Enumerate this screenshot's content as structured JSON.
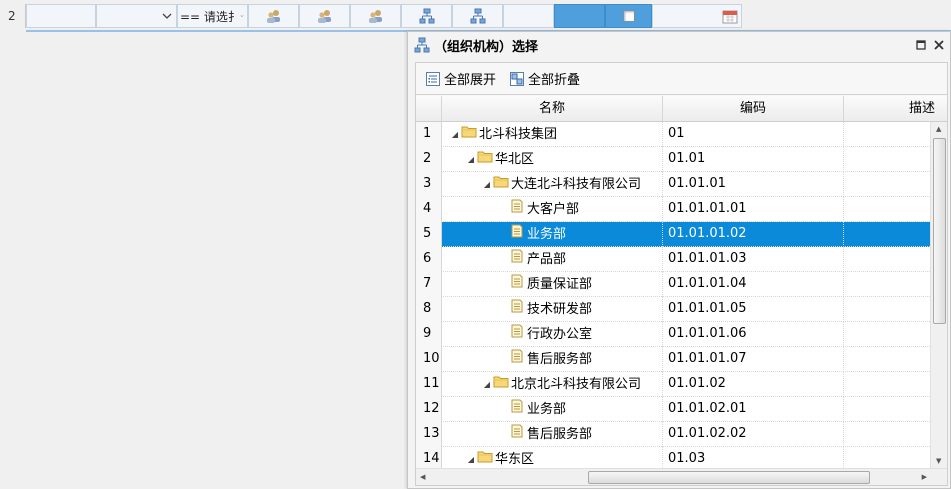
{
  "toprow": {
    "row_number": "2",
    "compare_text": "== 请选扌"
  },
  "dialog": {
    "title": "（组织机构）选择",
    "toolbar": {
      "expand_all": "全部展开",
      "collapse_all": "全部折叠"
    },
    "columns": [
      "名称",
      "编码",
      "描述"
    ],
    "rows": [
      {
        "num": "1",
        "level": 0,
        "type": "folder",
        "name": "北斗科技集团",
        "code": "01"
      },
      {
        "num": "2",
        "level": 1,
        "type": "folder",
        "name": "华北区",
        "code": "01.01"
      },
      {
        "num": "3",
        "level": 2,
        "type": "folder",
        "name": "大连北斗科技有限公司",
        "code": "01.01.01"
      },
      {
        "num": "4",
        "level": 3,
        "type": "leaf",
        "name": "大客户部",
        "code": "01.01.01.01"
      },
      {
        "num": "5",
        "level": 3,
        "type": "leaf",
        "name": "业务部",
        "code": "01.01.01.02"
      },
      {
        "num": "6",
        "level": 3,
        "type": "leaf",
        "name": "产品部",
        "code": "01.01.01.03"
      },
      {
        "num": "7",
        "level": 3,
        "type": "leaf",
        "name": "质量保证部",
        "code": "01.01.01.04"
      },
      {
        "num": "8",
        "level": 3,
        "type": "leaf",
        "name": "技术研发部",
        "code": "01.01.01.05"
      },
      {
        "num": "9",
        "level": 3,
        "type": "leaf",
        "name": "行政办公室",
        "code": "01.01.01.06"
      },
      {
        "num": "10",
        "level": 3,
        "type": "leaf",
        "name": "售后服务部",
        "code": "01.01.01.07"
      },
      {
        "num": "11",
        "level": 2,
        "type": "folder",
        "name": "北京北斗科技有限公司",
        "code": "01.01.02"
      },
      {
        "num": "12",
        "level": 3,
        "type": "leaf",
        "name": "业务部",
        "code": "01.01.02.01"
      },
      {
        "num": "13",
        "level": 3,
        "type": "leaf",
        "name": "售后服务部",
        "code": "01.01.02.02"
      },
      {
        "num": "14",
        "level": 1,
        "type": "folder",
        "name": "华东区",
        "code": "01.03"
      }
    ],
    "selected_row": "5"
  },
  "colors": {
    "selected_row": "#0a8ad9",
    "selected_cell": "#4f9fdc",
    "header_bar": "#9bc1e6"
  },
  "icons": [
    "chevron-down-icon",
    "user-group-icon",
    "org-tree-icon",
    "checkbox-icon",
    "calendar-icon",
    "maximize-icon",
    "close-icon",
    "expand-all-icon",
    "collapse-all-icon",
    "folder-icon",
    "document-icon"
  ]
}
